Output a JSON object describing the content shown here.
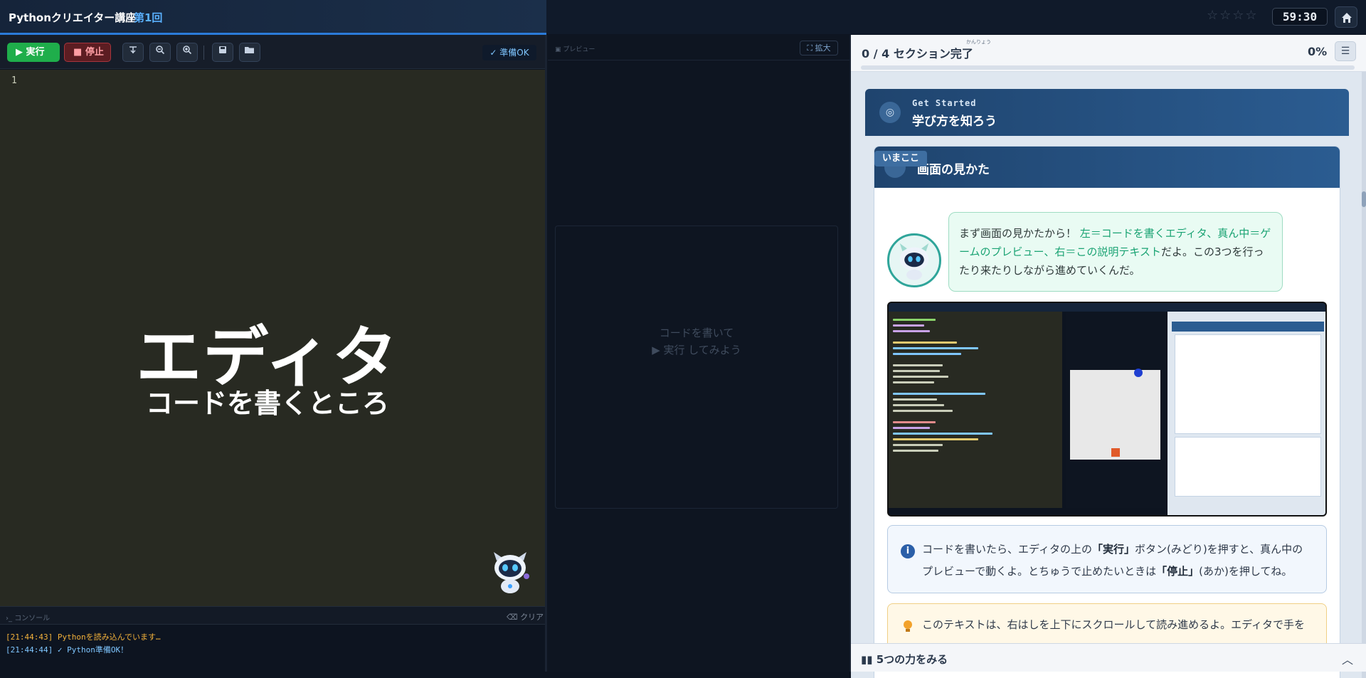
{
  "header": {
    "app_title": "Pythonクリエイター講座",
    "episode": "第1回",
    "stars": "☆☆☆☆",
    "timer": "59:30",
    "home_icon": "home-icon"
  },
  "editor": {
    "run_label": "実行",
    "stop_label": "停止",
    "ready_label": "✓ 準備OK",
    "line_number": "1",
    "overlay_title": "エディタ",
    "overlay_subtitle": "コードを書くところ",
    "tools": [
      "format-icon",
      "zoom-out-icon",
      "zoom-in-icon",
      "save-icon",
      "folder-open-icon"
    ]
  },
  "console": {
    "label": "コンソール",
    "clear_label": "クリア",
    "logs": [
      "[21:44:43] Pythonを読み込んでいます…",
      "[21:44:44] ✓ Python準備OK！"
    ],
    "colors": {
      "loading": "#f2b13a",
      "ok": "#7fc6ff"
    }
  },
  "preview": {
    "label": "プレビュー",
    "expand_label": "拡大",
    "hint_line1": "コードを書いて",
    "hint_line2": "▶ 実行 してみよう"
  },
  "lesson": {
    "progress_text": "0 / 4 セクション完了",
    "progress_ruby": "かんりょう",
    "progress_percent": "0%",
    "progress_value": 0,
    "section_eyebrow": "Get Started",
    "section_title": "学び方を知ろう",
    "here_badge": "いまここ",
    "page_title": "画面の見かた",
    "bubble_intro": "まず画面の見かたから！",
    "bubble_highlight": "左＝コードを書くエディタ、真ん中＝ゲームのプレビュー、右＝この説明テキスト",
    "bubble_rest": "だよ。この3つを行ったり来たりしながら進めていくんだ。",
    "info_part1": "コードを書いたら、エディタの上の",
    "info_run": "「実行」",
    "info_part2": "ボタン(みどり)を押すと、真ん中のプレビューで動くよ。とちゅうで止めたいときは",
    "info_stop": "「停止」",
    "info_part3": "(あか)を押してね。",
    "tip_text": "このテキストは、右はしを上下にスクロールして読み進めるよ。エディタで手を",
    "footer_label": "5つの力をみる",
    "accent": "#2b7bd9",
    "run_color": "#1fae4b",
    "stop_color": "#a8353d"
  }
}
